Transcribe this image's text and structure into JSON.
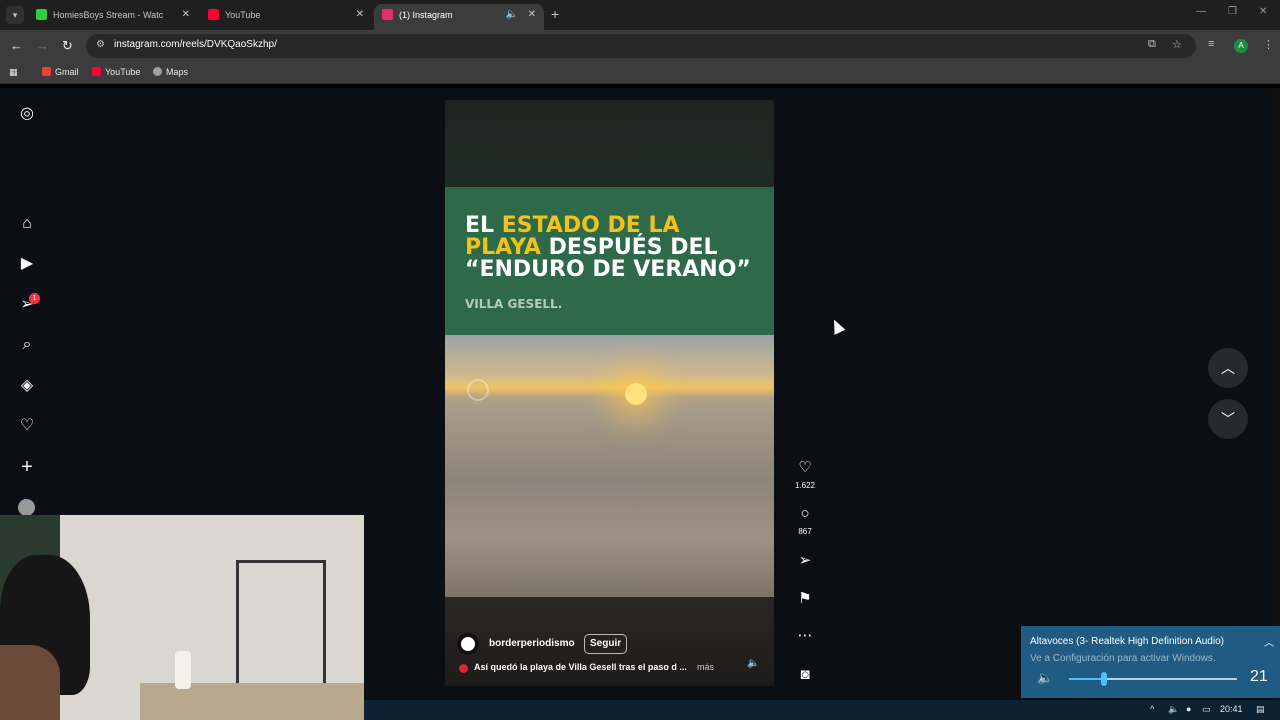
{
  "browser": {
    "tabs": [
      {
        "title": "HomiesBoys Stream - Watch Li",
        "icon_color": "#2ecc40",
        "active": false
      },
      {
        "title": "YouTube",
        "icon_color": "#ff0033",
        "active": false
      },
      {
        "title": "(1) Instagram",
        "icon_color": "#e1306c",
        "active": true
      }
    ],
    "url": "instagram.com/reels/DVKQaoSkzhp/",
    "profile_initial": "A",
    "bookmarks": [
      {
        "label": "Gmail",
        "icon_color": "#ea4335"
      },
      {
        "label": "YouTube",
        "icon_color": "#ff0033"
      },
      {
        "label": "Maps",
        "icon_color": "#9aa0a6"
      }
    ]
  },
  "sidebar": {
    "notification_count": "1"
  },
  "reel": {
    "headline_white_1": "EL ",
    "headline_yellow_1": "ESTADO DE LA",
    "headline_yellow_2": "PLAYA",
    "headline_white_2": " DESPUÉS DEL",
    "headline_white_3": "“ENDURO DE VERANO”",
    "subline": "VILLA GESELL.",
    "author": "borderperiodismo",
    "follow_label": "Seguir",
    "caption": "Así quedó la playa de Villa Gesell tras el paso d ...",
    "more_label": "más",
    "likes": "1.622",
    "comments": "867"
  },
  "volume": {
    "device": "Altavoces (3- Realtek High Definition Audio)",
    "activation_notice": "Ve a Configuración para activar Windows.",
    "level": 21
  },
  "taskbar": {
    "clock": "20:41"
  }
}
